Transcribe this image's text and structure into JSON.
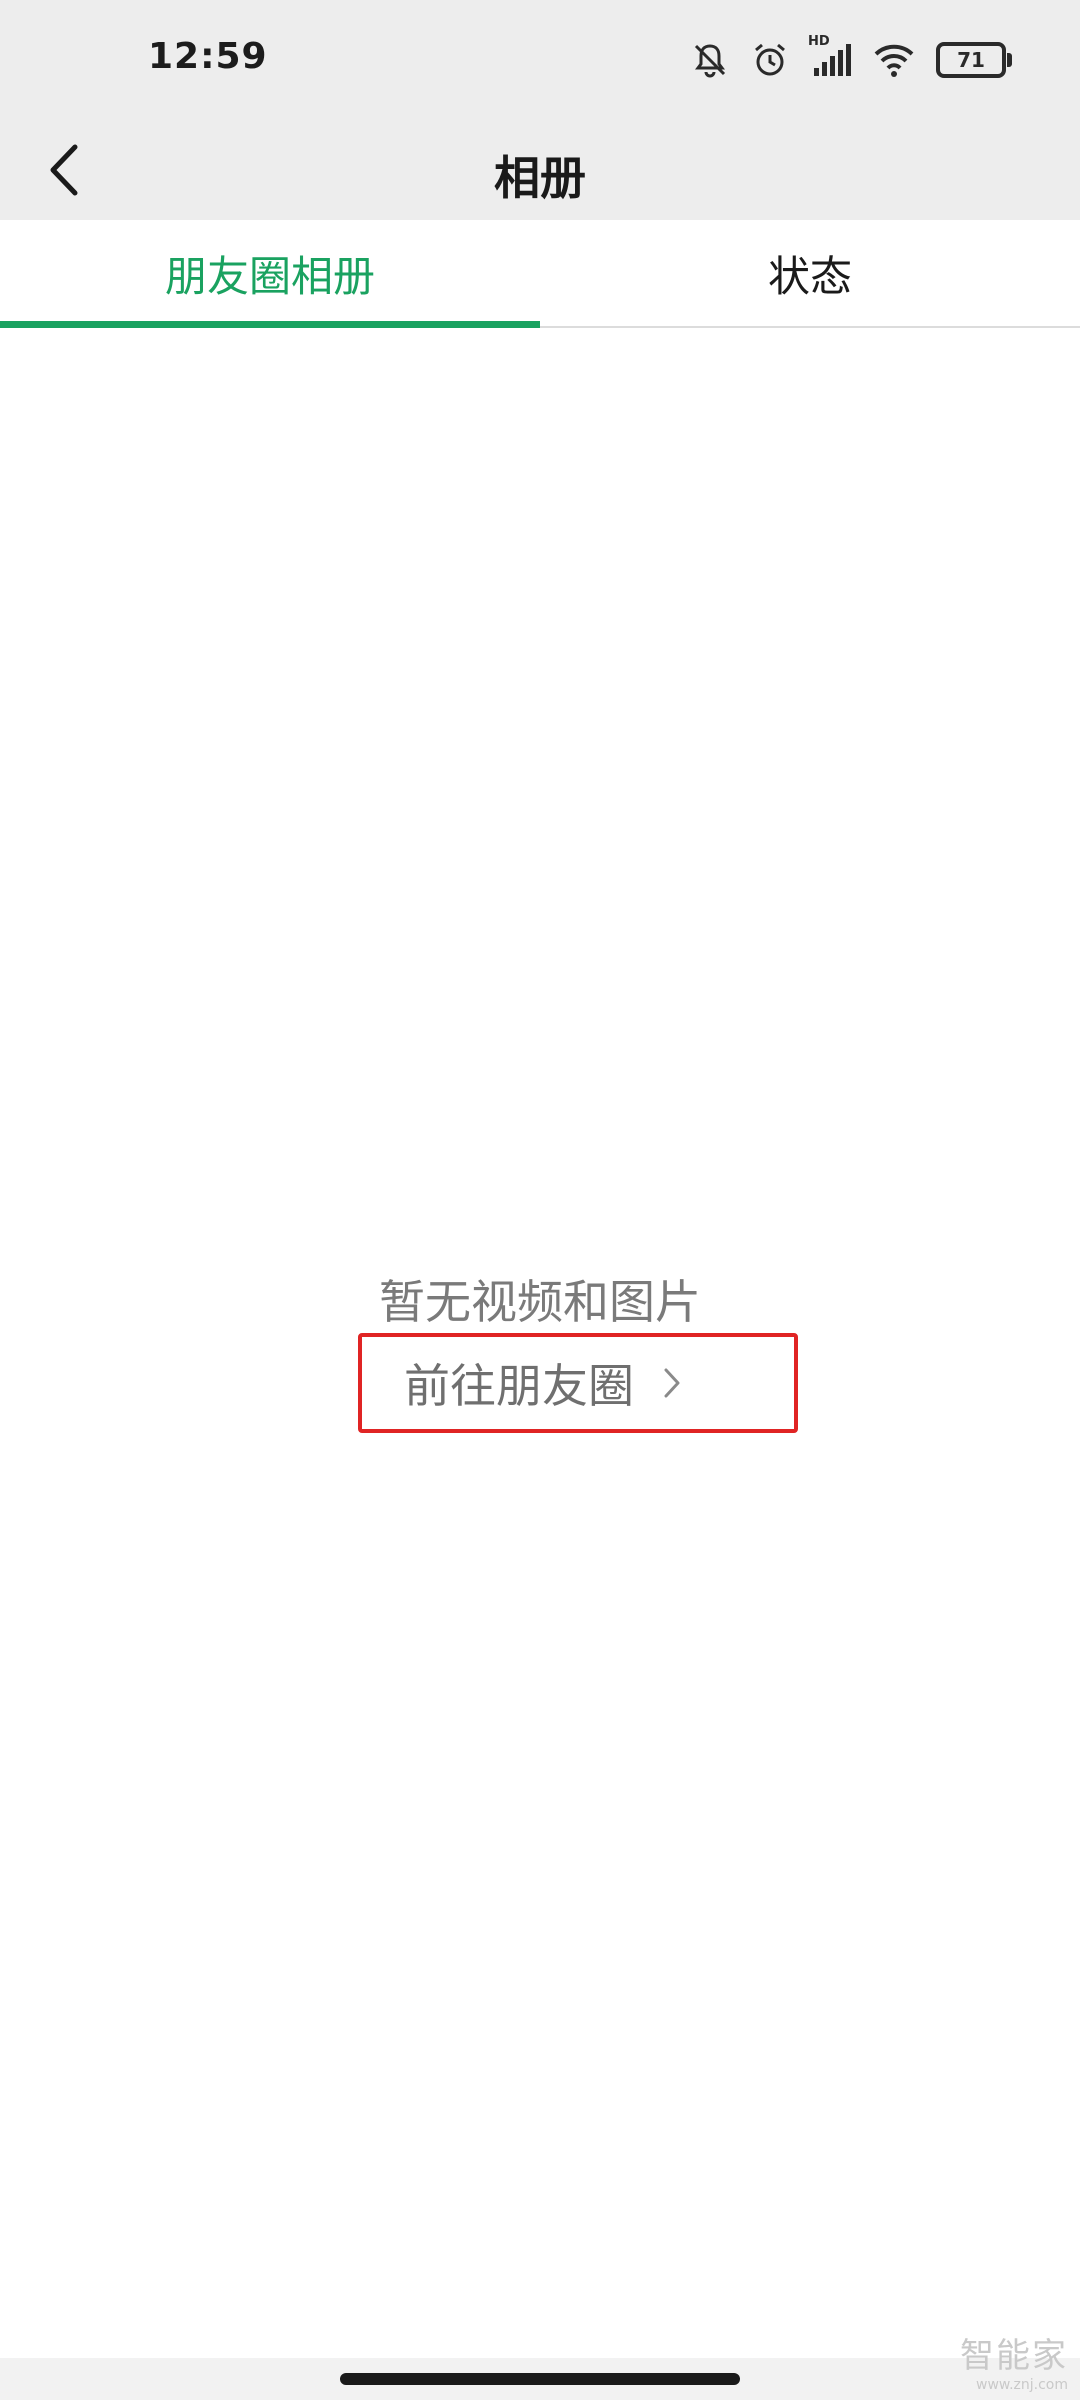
{
  "status_bar": {
    "time": "12:59",
    "network_label": "HD",
    "battery_level": "71",
    "icons": [
      "mute-bell-icon",
      "alarm-icon",
      "signal-icon",
      "wifi-icon",
      "battery-icon"
    ]
  },
  "header": {
    "title": "相册",
    "back_icon": "chevron-left-icon"
  },
  "tabs": [
    {
      "label": "朋友圈相册",
      "active": true
    },
    {
      "label": "状态",
      "active": false
    }
  ],
  "empty_state": {
    "message": "暂无视频和图片",
    "link_label": "前往朋友圈",
    "link_icon": "chevron-right-icon"
  },
  "watermark": {
    "text": "智能家",
    "url": "www.znj.com"
  },
  "colors": {
    "accent": "#1aa260",
    "highlight_box": "#e02424",
    "header_bg": "#ededed"
  }
}
